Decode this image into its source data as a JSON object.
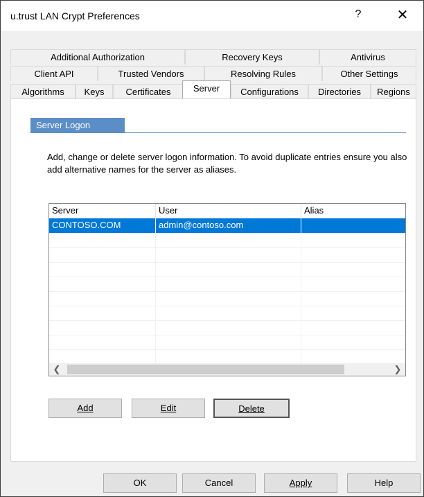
{
  "window": {
    "title": "u.trust LAN Crypt Preferences",
    "help_glyph": "?",
    "close_glyph": "✕"
  },
  "tabs": {
    "row1": [
      "Additional Authorization",
      "Recovery Keys",
      "Antivirus"
    ],
    "row2": [
      "Client API",
      "Trusted Vendors",
      "Resolving Rules",
      "Other Settings"
    ],
    "row3": [
      "Algorithms",
      "Keys",
      "Certificates",
      "Server",
      "Configurations",
      "Directories",
      "Regions"
    ],
    "active": "Server"
  },
  "panel": {
    "group_title": "Server Logon",
    "description": "Add, change or delete server logon information. To avoid duplicate entries ensure you also add alternative names for the server as aliases."
  },
  "table": {
    "columns": [
      "Server",
      "User",
      "Alias"
    ],
    "rows": [
      {
        "server": "CONTOSO.COM",
        "user": "admin@contoso.com",
        "alias": "",
        "selected": true
      }
    ]
  },
  "panel_buttons": {
    "add": "Add",
    "edit": "Edit",
    "delete": "Delete"
  },
  "dialog_buttons": {
    "ok": "OK",
    "cancel": "Cancel",
    "apply": "Apply",
    "help": "Help"
  },
  "icons": {
    "scroll_left": "scroll-left-icon",
    "scroll_right": "scroll-right-icon"
  },
  "colors": {
    "accent": "#0078d7",
    "group_header": "#5b8dc6"
  }
}
